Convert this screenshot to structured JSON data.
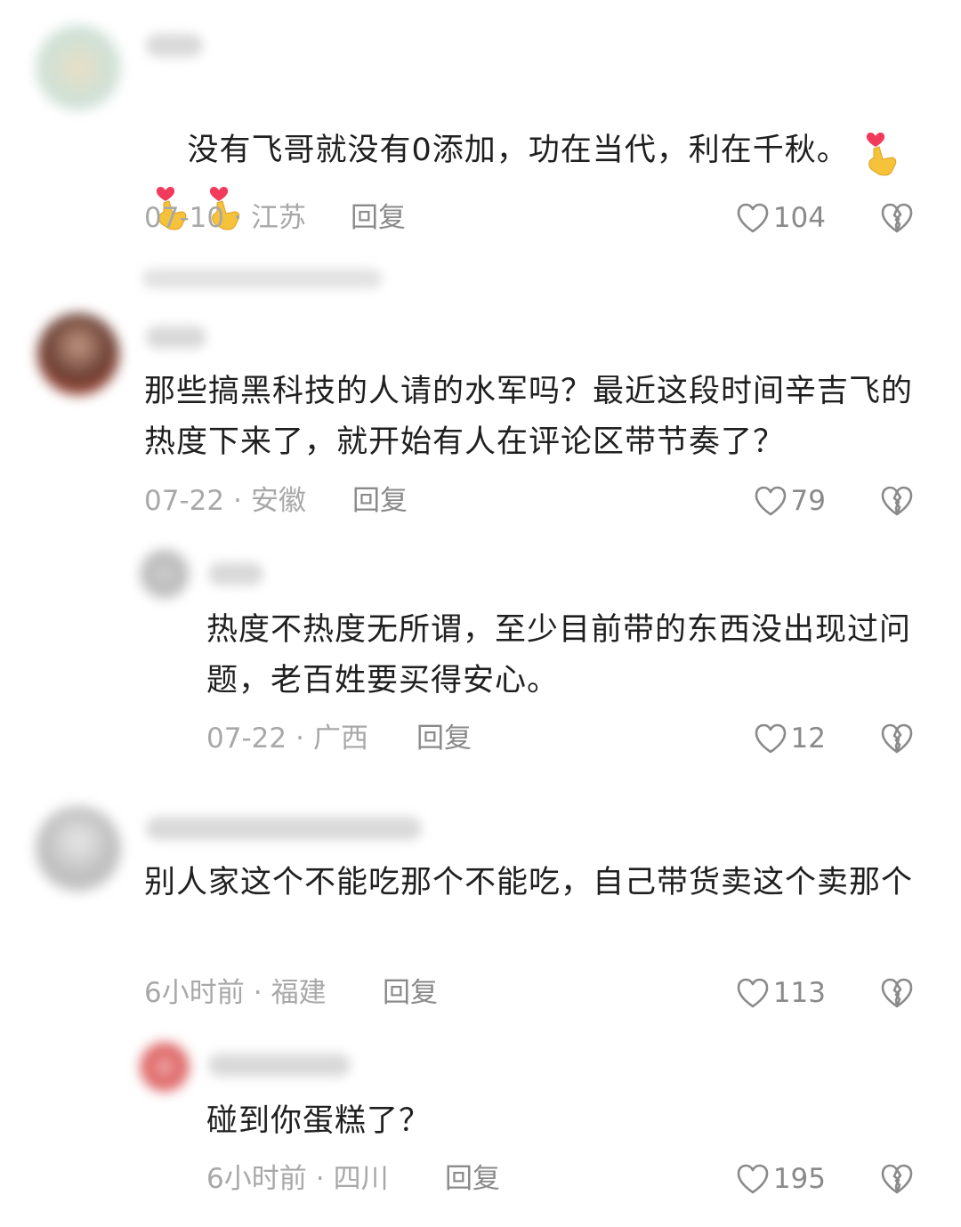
{
  "comments": [
    {
      "text": "没有飞哥就没有0添加，功在当代，利在千秋。",
      "date": "07-10",
      "location": "江苏",
      "reply_label": "回复",
      "likes": "104",
      "emoji": "finger-heart-emoji"
    },
    {
      "text": "那些搞黑科技的人请的水军吗？最近这段时间辛吉飞的热度下来了，就开始有人在评论区带节奏了？",
      "date": "07-22",
      "location": "安徽",
      "reply_label": "回复",
      "likes": "79"
    },
    {
      "text": "热度不热度无所谓，至少目前带的东西没出现过问题，老百姓要买得安心。",
      "date": "07-22",
      "location": "广西",
      "reply_label": "回复",
      "likes": "12"
    },
    {
      "text": "别人家这个不能吃那个不能吃，自己带货卖这个卖那个",
      "date": "6小时前",
      "location": "福建",
      "reply_label": "回复",
      "likes": "113"
    },
    {
      "text": "碰到你蛋糕了？",
      "date": "6小时前",
      "location": "四川",
      "reply_label": "回复",
      "likes": "195"
    }
  ],
  "colors": {
    "meta": "#a8a8a8",
    "text": "#1f1f1f",
    "heart_emoji": "#f23b5c",
    "hand_emoji": "#f6c23a"
  },
  "icons": {
    "like": "heart-outline-icon",
    "dislike": "broken-heart-icon"
  }
}
